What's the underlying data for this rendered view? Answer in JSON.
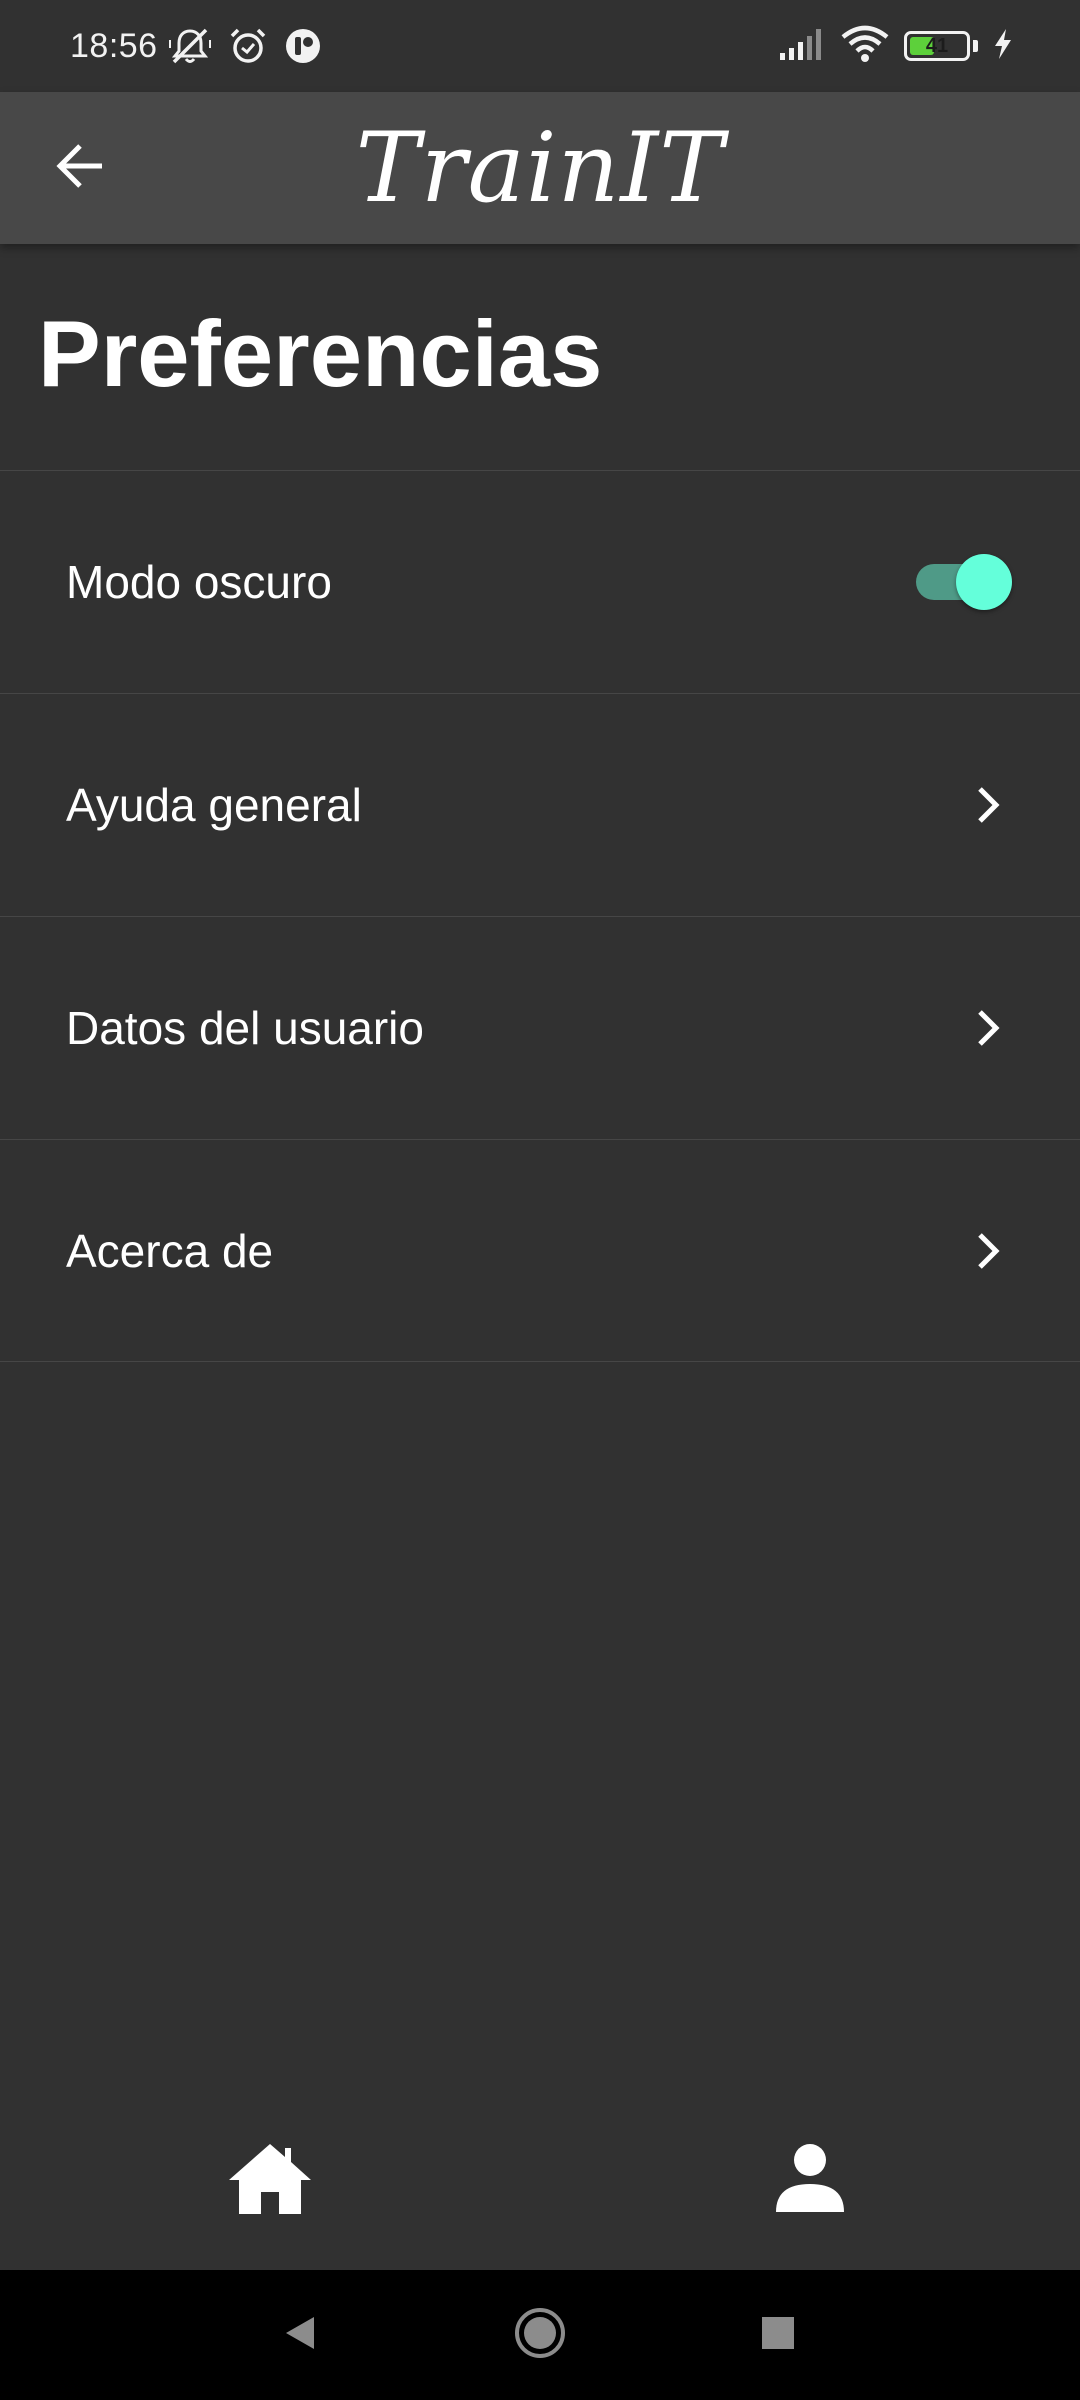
{
  "status_bar": {
    "time": "18:56",
    "battery_level": "41",
    "icons": [
      "muted-bell-icon",
      "alarm-icon",
      "app-notification-icon",
      "signal-icon",
      "wifi-icon",
      "battery-icon",
      "charging-icon"
    ]
  },
  "app_bar": {
    "title": "TrainIT",
    "back_icon": "arrow-back-icon"
  },
  "page": {
    "title": "Preferencias"
  },
  "settings": {
    "items": [
      {
        "label": "Modo oscuro",
        "type": "toggle",
        "checked": true
      },
      {
        "label": "Ayuda general",
        "type": "link",
        "icon": "chevron-right-icon"
      },
      {
        "label": "Datos del usuario",
        "type": "link",
        "icon": "chevron-right-icon"
      },
      {
        "label": "Acerca de",
        "type": "link",
        "icon": "chevron-right-icon"
      }
    ]
  },
  "bottom_nav": {
    "items": [
      {
        "icon": "home-icon"
      },
      {
        "icon": "person-icon"
      }
    ]
  },
  "system_nav": {
    "buttons": [
      "back-triangle-icon",
      "home-circle-icon",
      "recents-square-icon"
    ]
  },
  "colors": {
    "background": "#313131",
    "app_bar": "#484848",
    "toggle_thumb": "#64ffda",
    "toggle_track": "#4f9a87",
    "battery_fill": "#5dd03b",
    "text": "#ffffff"
  }
}
